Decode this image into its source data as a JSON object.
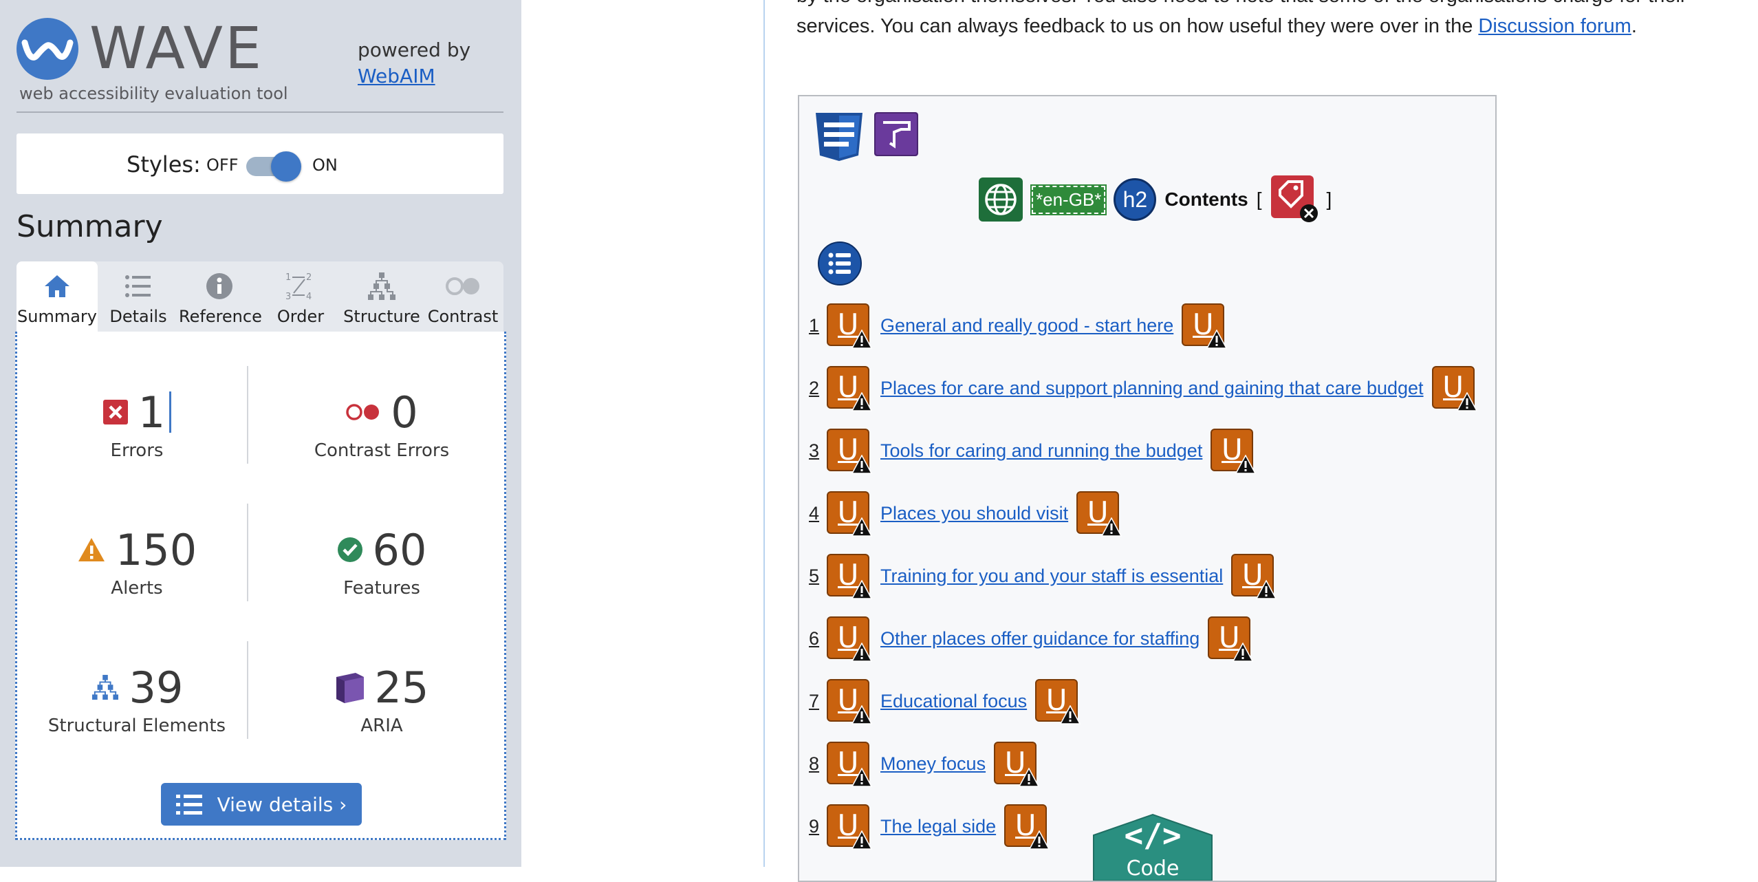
{
  "sidebar": {
    "brand": "WAVE",
    "tagline": "web accessibility evaluation tool",
    "powered_by": "powered by",
    "webaim_link": "WebAIM",
    "styles": {
      "label": "Styles:",
      "off": "OFF",
      "on": "ON",
      "state": "on"
    },
    "heading": "Summary",
    "tabs": [
      {
        "label": "Summary",
        "icon": "home-icon",
        "active": true
      },
      {
        "label": "Details",
        "icon": "details-list-icon",
        "active": false
      },
      {
        "label": "Reference",
        "icon": "info-icon",
        "active": false
      },
      {
        "label": "Order",
        "icon": "order-icon",
        "active": false
      },
      {
        "label": "Structure",
        "icon": "structure-icon",
        "active": false
      },
      {
        "label": "Contrast",
        "icon": "contrast-icon",
        "active": false
      }
    ],
    "stats": {
      "errors": {
        "value": "1",
        "label": "Errors"
      },
      "contrast": {
        "value": "0",
        "label": "Contrast Errors"
      },
      "alerts": {
        "value": "150",
        "label": "Alerts"
      },
      "features": {
        "value": "60",
        "label": "Features"
      },
      "structure": {
        "value": "39",
        "label": "Structural Elements"
      },
      "aria": {
        "value": "25",
        "label": "ARIA"
      }
    },
    "view_details": "View details ›"
  },
  "page": {
    "intro_text": "by the organisation themselves. You also need to note that some of the organisations charge for their services. You can always feedback to us on how useful they were over in the ",
    "intro_link": "Discussion forum",
    "intro_end": ".",
    "lang_chip": "*en-GB*",
    "h2_badge": "h2",
    "contents_label": "Contents",
    "bracket_open": "[",
    "bracket_close": "]",
    "toc": [
      {
        "num": "1",
        "text": "General and really good - start here"
      },
      {
        "num": "2",
        "text": "Places for care and support planning and gaining that care budget"
      },
      {
        "num": "3",
        "text": "Tools for caring and running the budget"
      },
      {
        "num": "4",
        "text": "Places you should visit"
      },
      {
        "num": "5",
        "text": "Training for you and your staff is essential"
      },
      {
        "num": "6",
        "text": "Other places offer guidance for staffing"
      },
      {
        "num": "7",
        "text": "Educational focus"
      },
      {
        "num": "8",
        "text": "Money focus"
      },
      {
        "num": "9",
        "text": "The legal side"
      }
    ],
    "code_button": {
      "glyph": "</>",
      "label": "Code"
    }
  },
  "colors": {
    "wave_blue": "#3f78c6",
    "error_red": "#c8323c",
    "alert_orange": "#e08a1e",
    "feature_green": "#2f8a5a",
    "aria_purple": "#5a3a8c",
    "ubadge_orange": "#c9620f",
    "link_blue": "#1a5ec4"
  }
}
